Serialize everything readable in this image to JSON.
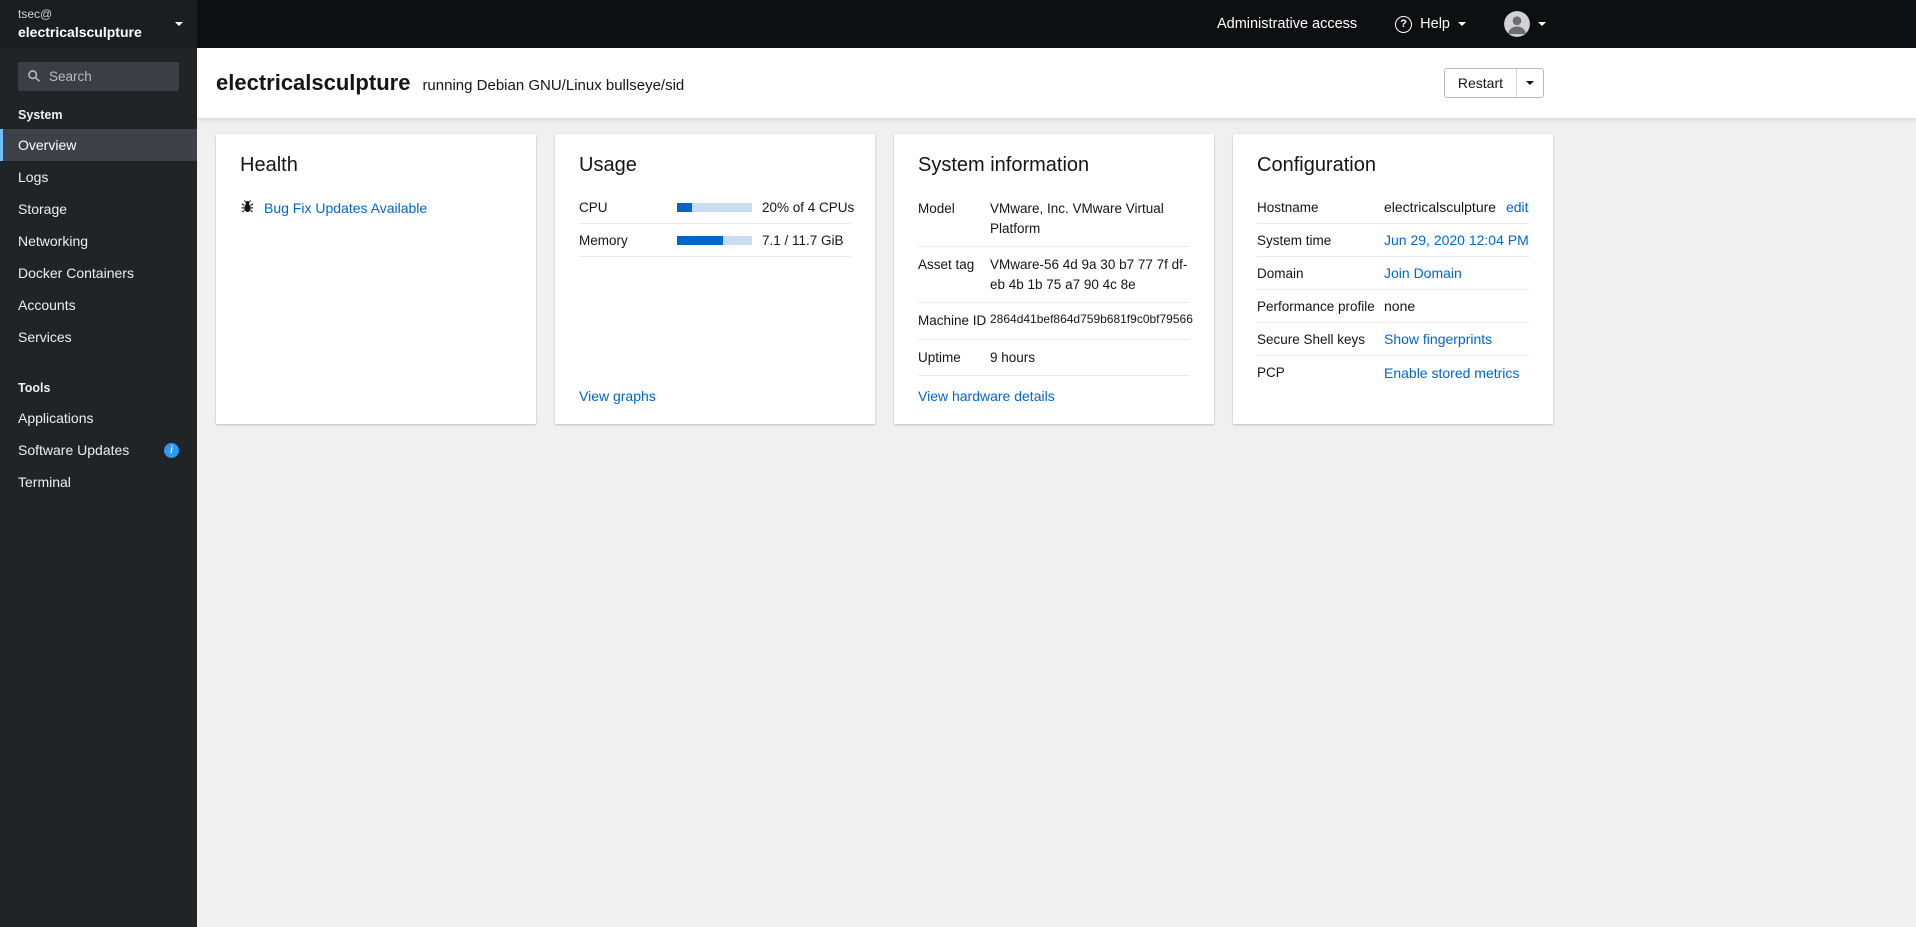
{
  "colors": {
    "link": "#0066cc",
    "progress-fill": "#0066cc",
    "progress-track": "#cbdcee",
    "nav-active-border": "#73bcf7",
    "info": "#2b9af3"
  },
  "brand": {
    "user": "tsec@",
    "host": "electricalsculpture"
  },
  "masthead": {
    "admin_access_label": "Administrative access",
    "help_label": "Help"
  },
  "sidebar": {
    "search_placeholder": "Search",
    "sections": [
      {
        "label": "System",
        "items": [
          {
            "label": "Overview"
          },
          {
            "label": "Logs"
          },
          {
            "label": "Storage"
          },
          {
            "label": "Networking"
          },
          {
            "label": "Docker Containers"
          },
          {
            "label": "Accounts"
          },
          {
            "label": "Services"
          }
        ]
      },
      {
        "label": "Tools",
        "items": [
          {
            "label": "Applications"
          },
          {
            "label": "Software Updates"
          },
          {
            "label": "Terminal"
          }
        ]
      }
    ]
  },
  "header": {
    "hostname": "electricalsculpture",
    "os_text": "running Debian GNU/Linux bullseye/sid",
    "restart_label": "Restart"
  },
  "health": {
    "title": "Health",
    "update_link": "Bug Fix Updates Available"
  },
  "usage": {
    "title": "Usage",
    "rows": [
      {
        "label": "CPU",
        "percent": 20,
        "text": "20% of 4 CPUs"
      },
      {
        "label": "Memory",
        "percent": 61,
        "text": "7.1 / 11.7 GiB"
      }
    ],
    "view_link": "View graphs"
  },
  "system_info": {
    "title": "System information",
    "rows": [
      {
        "label": "Model",
        "value": "VMware, Inc. VMware Virtual Platform"
      },
      {
        "label": "Asset tag",
        "value": "VMware-56 4d 9a 30 b7 77 7f df-eb 4b 1b 75 a7 90 4c 8e"
      },
      {
        "label": "Machine ID",
        "value": "2864d41bef864d759b681f9c0bf79566"
      },
      {
        "label": "Uptime",
        "value": "9 hours"
      }
    ],
    "view_link": "View hardware details"
  },
  "configuration": {
    "title": "Configuration",
    "rows": [
      {
        "label": "Hostname",
        "value": "electricalsculpture",
        "link": "edit"
      },
      {
        "label": "System time",
        "link": "Jun 29, 2020 12:04 PM"
      },
      {
        "label": "Domain",
        "link": "Join Domain"
      },
      {
        "label": "Performance profile",
        "value": "none"
      },
      {
        "label": "Secure Shell keys",
        "link": "Show fingerprints"
      },
      {
        "label": "PCP",
        "link": "Enable stored metrics"
      }
    ]
  }
}
